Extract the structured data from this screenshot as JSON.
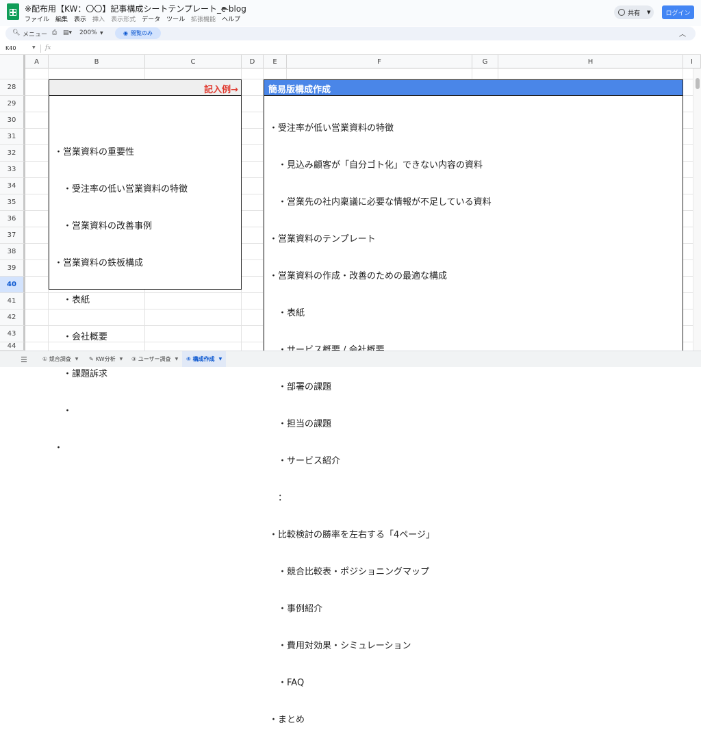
{
  "header": {
    "title": "※配布用【KW：〇〇】記事構成シートテンプレート_c-blog",
    "menu": [
      "ファイル",
      "編集",
      "表示",
      "挿入",
      "表示形式",
      "データ",
      "ツール",
      "拡張機能",
      "ヘルプ"
    ],
    "share_label": "共有",
    "login_label": "ログイン"
  },
  "toolbar": {
    "menus_label": "メニュー",
    "zoom": "200%",
    "view_only_label": "閲覧のみ"
  },
  "formula_bar": {
    "cell_ref": "K40",
    "fx_label": "fx"
  },
  "columns": [
    "A",
    "B",
    "C",
    "D",
    "E",
    "F",
    "G",
    "H",
    "I"
  ],
  "rows": [
    "28",
    "29",
    "30",
    "31",
    "32",
    "33",
    "34",
    "35",
    "36",
    "37",
    "38",
    "39",
    "40",
    "41",
    "42",
    "43",
    "44"
  ],
  "selected_row": "40",
  "example": {
    "label": "記入例→",
    "items": [
      "・営業資料の重要性",
      "　・受注率の低い営業資料の特徴",
      "　・営業資料の改善事例",
      "・営業資料の鉄板構成",
      "　・表紙",
      "　・会社概要",
      "　・課題訴求",
      "　・",
      "・"
    ]
  },
  "simple": {
    "title": "簡易版構成作成",
    "items": [
      "・受注率が低い営業資料の特徴",
      "　・見込み顧客が「自分ゴト化」できない内容の資料",
      "　・営業先の社内稟議に必要な情報が不足している資料",
      "・営業資料のテンプレート",
      "・営業資料の作成・改善のための最適な構成",
      "　・表紙",
      "　・サービス概要 / 会社概要",
      "　・部署の課題",
      "　・担当の課題",
      "　・サービス紹介",
      "　：",
      "・比較検討の勝率を左右する「4ページ」",
      "　・競合比較表・ポジショニングマップ",
      "　・事例紹介",
      "　・費用対効果・シミュレーション",
      "　・FAQ",
      "・まとめ"
    ]
  },
  "sheet_tabs": [
    {
      "label": "① 競合調査",
      "active": false
    },
    {
      "label": "KW分析",
      "active": false
    },
    {
      "label": "③ ユーザー調査",
      "active": false
    },
    {
      "label": "④ 構成作成",
      "active": true
    }
  ]
}
